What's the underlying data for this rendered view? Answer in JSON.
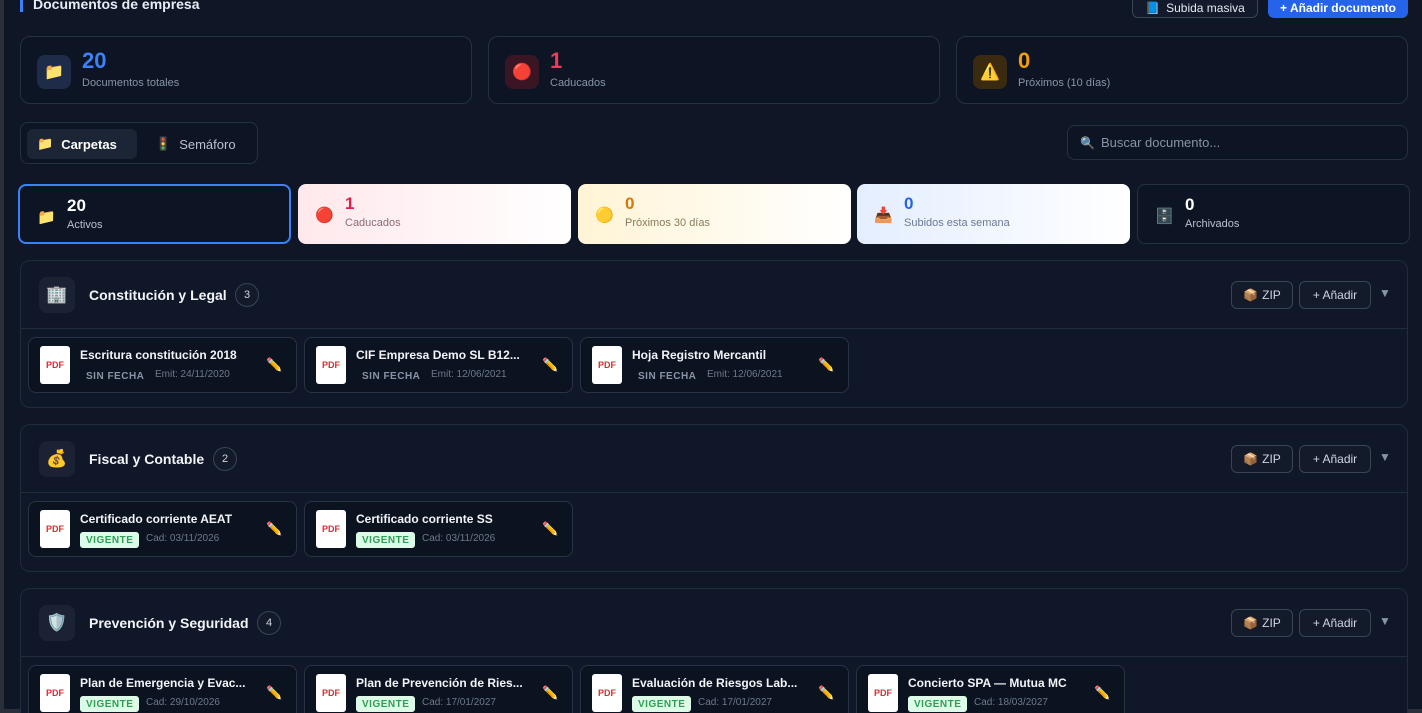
{
  "header": {
    "title": "Documentos de empresa",
    "mass_upload": "Subida masiva",
    "add_document": "+ Añadir documento"
  },
  "stats": [
    {
      "value": "20",
      "label": "Documentos totales",
      "color": "#3b82f6",
      "icon": "folder-icon"
    },
    {
      "value": "1",
      "label": "Caducados",
      "color": "#ef3b54",
      "icon": "red-circle-icon"
    },
    {
      "value": "0",
      "label": "Próximos (10 días)",
      "color": "#f59e0b",
      "icon": "warning-icon"
    }
  ],
  "view_toggle": {
    "folders": "Carpetas",
    "traffic_light": "Semáforo"
  },
  "search": {
    "placeholder": "Buscar documento..."
  },
  "filters": [
    {
      "value": "20",
      "label": "Activos",
      "icon": "folder-icon"
    },
    {
      "value": "1",
      "label": "Caducados",
      "icon": "red-circle-icon"
    },
    {
      "value": "0",
      "label": "Próximos 30 días",
      "icon": "yellow-circle-icon"
    },
    {
      "value": "0",
      "label": "Subidos esta semana",
      "icon": "upload-tray-icon"
    },
    {
      "value": "0",
      "label": "Archivados",
      "icon": "archive-cabinet-icon"
    }
  ],
  "section_actions": {
    "zip": "ZIP",
    "add": "+ Añadir"
  },
  "sections": [
    {
      "title": "Constitución y Legal",
      "count": "3",
      "icon": "building-icon",
      "docs": [
        {
          "name": "Escritura constitución 2018",
          "badge": "SIN FECHA",
          "date": "Emit: 24/11/2020"
        },
        {
          "name": "CIF Empresa Demo SL B12...",
          "badge": "SIN FECHA",
          "date": "Emit: 12/06/2021"
        },
        {
          "name": "Hoja Registro Mercantil",
          "badge": "SIN FECHA",
          "date": "Emit: 12/06/2021"
        }
      ]
    },
    {
      "title": "Fiscal y Contable",
      "count": "2",
      "icon": "money-bag-icon",
      "docs": [
        {
          "name": "Certificado corriente AEAT",
          "badge": "VIGENTE",
          "date": "Cad: 03/11/2026"
        },
        {
          "name": "Certificado corriente SS",
          "badge": "VIGENTE",
          "date": "Cad: 03/11/2026"
        }
      ]
    },
    {
      "title": "Prevención y Seguridad",
      "count": "4",
      "icon": "shield-icon",
      "docs": [
        {
          "name": "Plan de Emergencia y Evac...",
          "badge": "VIGENTE",
          "date": "Cad: 29/10/2026"
        },
        {
          "name": "Plan de Prevención de Ries...",
          "badge": "VIGENTE",
          "date": "Cad: 17/01/2027"
        },
        {
          "name": "Evaluación de Riesgos Lab...",
          "badge": "VIGENTE",
          "date": "Cad: 17/01/2027"
        },
        {
          "name": "Concierto SPA — Mutua MC",
          "badge": "VIGENTE",
          "date": "Cad: 18/03/2027"
        }
      ]
    }
  ],
  "pdf_label": "PDF"
}
